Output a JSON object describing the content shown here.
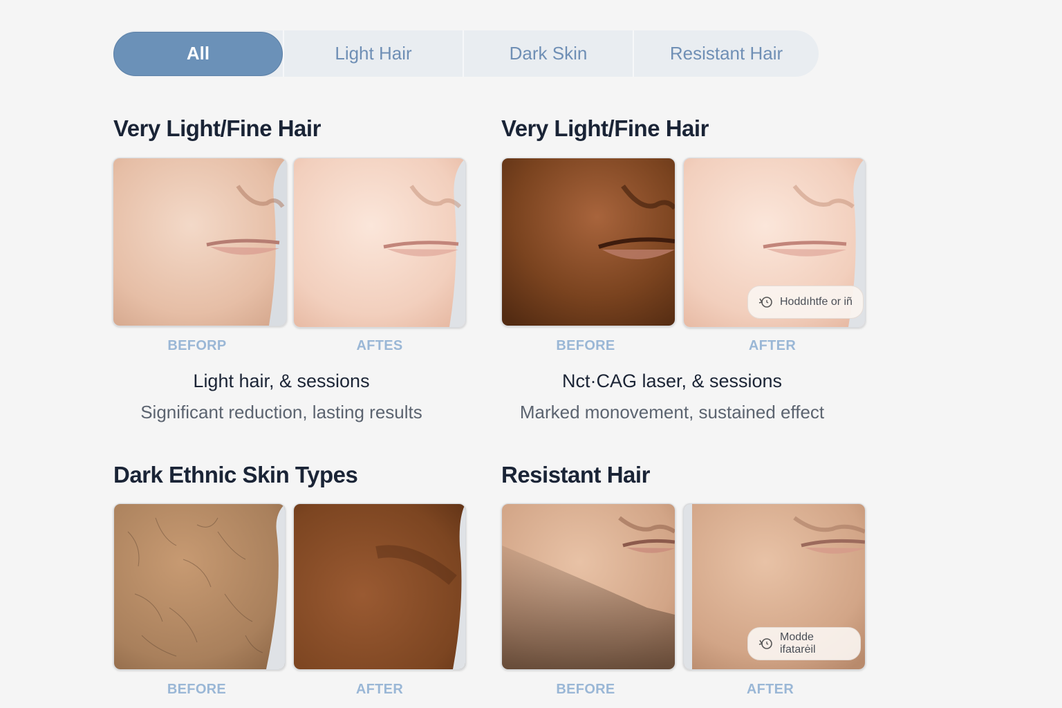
{
  "tabs": [
    {
      "label": "All",
      "active": true
    },
    {
      "label": "Light Hair",
      "active": false
    },
    {
      "label": "Dark Skin",
      "active": false
    },
    {
      "label": "Resistant Hair",
      "active": false
    }
  ],
  "cards": [
    {
      "title": "Very Light/Fine Hair",
      "before_label": "BEFORP",
      "after_label": "AFTES",
      "subtitle": "Light hair, & sessions",
      "description": "Significant reduction, lasting results"
    },
    {
      "title": "Very Light/Fine Hair",
      "before_label": "BEFORE",
      "after_label": "AFTER",
      "subtitle": "Nct·CAG laser, & sessions",
      "description": "Marked monovement, sustained effect",
      "badge": "Hoddıhtfe or iñ"
    },
    {
      "title": "Dark Ethnic Skin Types",
      "before_label": "BEFORE",
      "after_label": "AFTER"
    },
    {
      "title": "Resistant Hair",
      "before_label": "BEFORE",
      "after_label": "AFTER",
      "badge": "Modde ifatarėil"
    }
  ],
  "colors": {
    "accent": "#6b91b8",
    "tab_text": "#6f8fb5",
    "caption": "#9ab7d6",
    "background": "#f5f5f5"
  },
  "icons": [
    "rotate-history-icon"
  ]
}
